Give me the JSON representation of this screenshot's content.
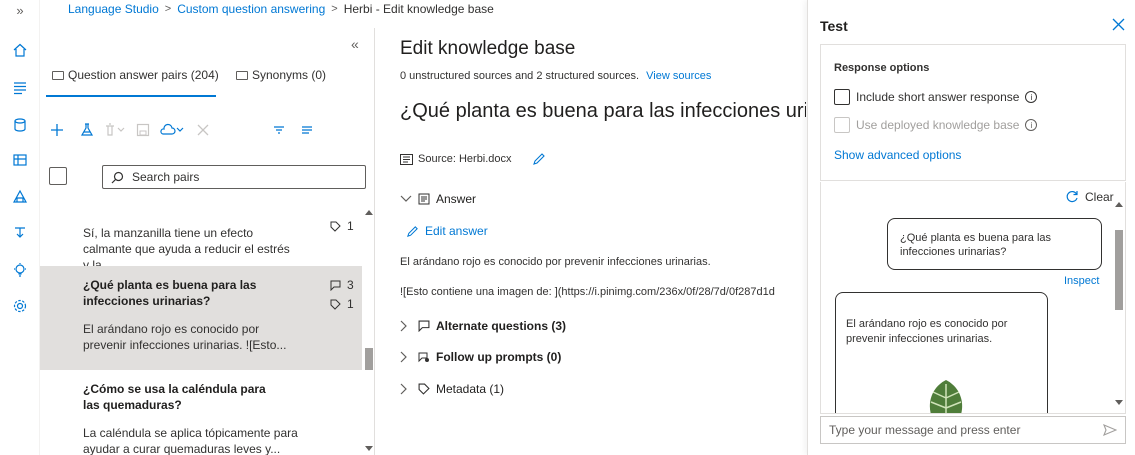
{
  "breadcrumb": {
    "items": [
      "Language Studio",
      "Custom question answering",
      "Herbi - Edit knowledge base"
    ],
    "separator": ">"
  },
  "left_rail": {
    "expand_glyph": "»",
    "items": [
      "home-icon",
      "list-icon",
      "database-icon",
      "knowledge-base-icon",
      "deploy-icon",
      "analytics-icon",
      "lightbulb-icon",
      "settings-icon"
    ]
  },
  "list_pane": {
    "collapse_glyph": "«",
    "tabs": [
      {
        "label": "Question answer pairs (204)",
        "selected": true
      },
      {
        "label": "Synonyms (0)",
        "selected": false
      }
    ],
    "search_placeholder": "Search pairs",
    "items": [
      {
        "question": "",
        "answer": "Sí, la manzanilla tiene un efecto calmante que ayuda a reducir el estrés y la...",
        "metadata_count": "1",
        "alt_count": ""
      },
      {
        "question": "¿Qué planta es buena para las infecciones urinarias?",
        "answer": "El arándano rojo es conocido por prevenir infecciones urinarias. ![Esto...",
        "metadata_count": "1",
        "alt_count": "3",
        "selected": true
      },
      {
        "question": "¿Cómo se usa la caléndula para las quemaduras?",
        "answer": "La caléndula se aplica tópicamente para ayudar a curar quemaduras leves y...",
        "metadata_count": "",
        "alt_count": ""
      }
    ]
  },
  "main": {
    "title": "Edit knowledge base",
    "sources_text": "0 unstructured sources and 2 structured sources.",
    "view_sources": "View sources",
    "question": "¿Qué planta es buena para las infecciones uri",
    "source_label": "Source: Herbi.docx",
    "answer_label": "Answer",
    "edit_answer": "Edit answer",
    "answer_text": "El arándano rojo es conocido por prevenir infecciones urinarias.",
    "answer_markdown": "![Esto contiene una imagen de: ](https://i.pinimg.com/236x/0f/28/7d/0f287d1d",
    "sections": [
      {
        "label": "Alternate questions (3)"
      },
      {
        "label": "Follow up prompts (0)"
      },
      {
        "label": "Metadata (1)"
      }
    ]
  },
  "test_panel": {
    "title": "Test",
    "response_options_title": "Response options",
    "include_short_answer": "Include short answer response",
    "use_deployed": "Use deployed knowledge base",
    "show_advanced": "Show advanced options",
    "clear": "Clear",
    "user_message": "¿Qué planta es buena para las infecciones urinarias?",
    "inspect": "Inspect",
    "bot_message": "El arándano rojo es conocido por prevenir infecciones urinarias.",
    "input_placeholder": "Type your message and press enter"
  },
  "colors": {
    "accent": "#0078d4",
    "selected_row": "#e1dfdd",
    "text": "#323130"
  }
}
